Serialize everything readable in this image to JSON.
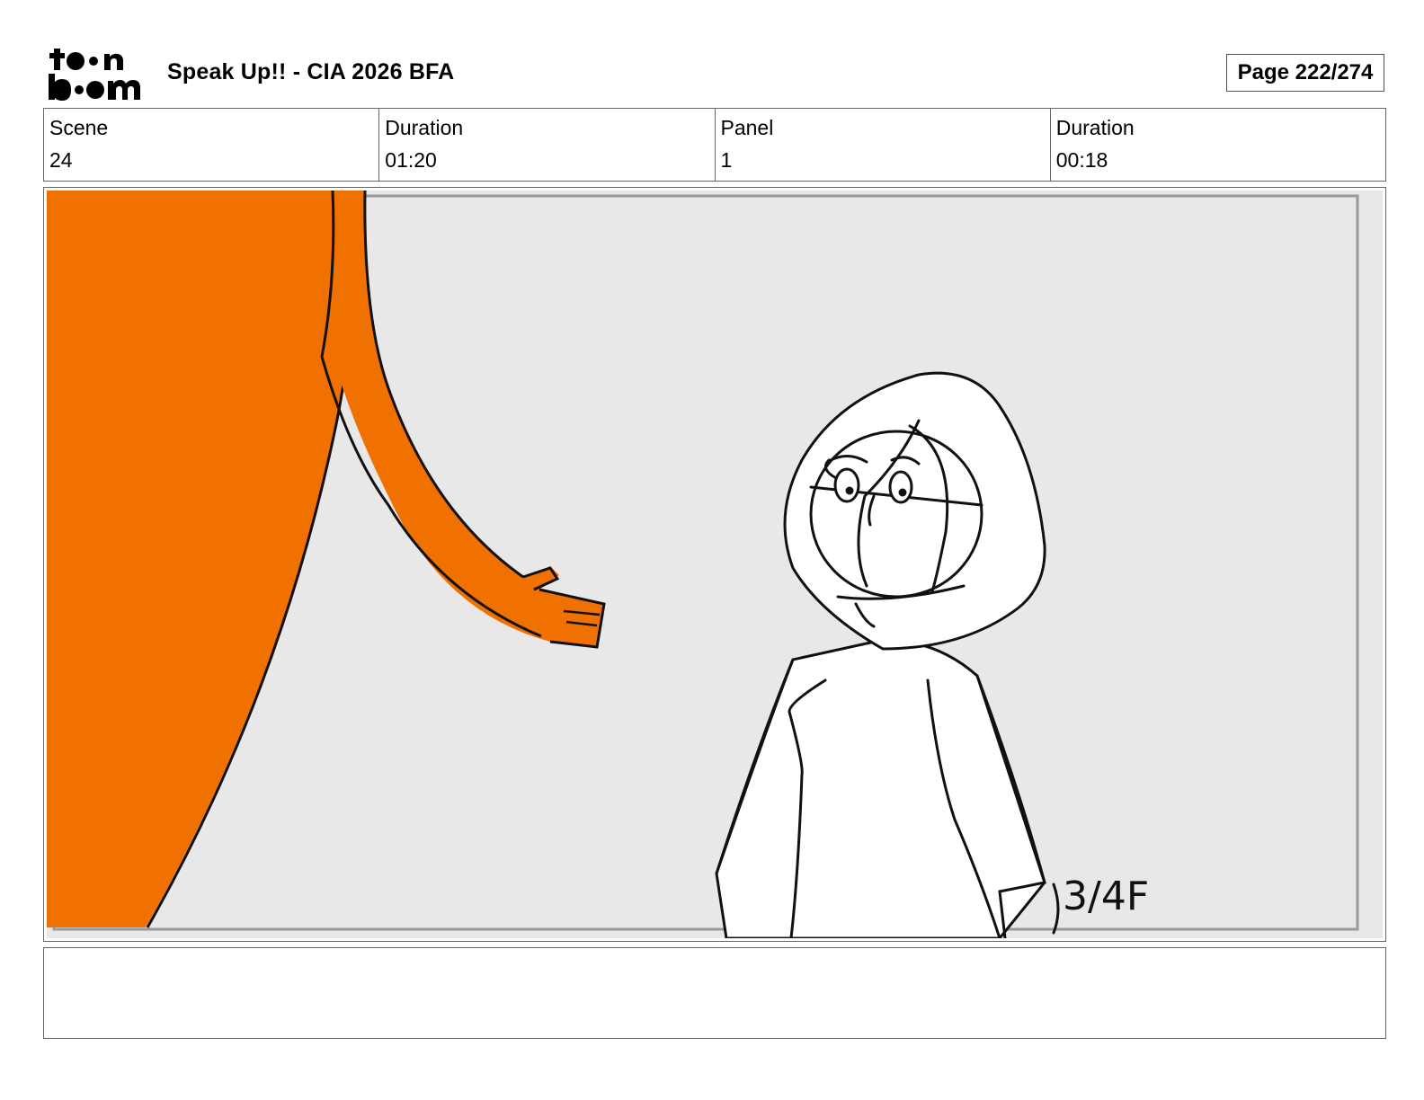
{
  "header": {
    "logo_text": "toon boom",
    "project_title": "Speak Up!! - CIA 2026 BFA",
    "page_label": "Page 222/274"
  },
  "info": [
    {
      "label": "Scene",
      "value": "24"
    },
    {
      "label": "Duration",
      "value": "01:20"
    },
    {
      "label": "Panel",
      "value": "1"
    },
    {
      "label": "Duration",
      "value": "00:18"
    }
  ],
  "panel": {
    "annotation": "3/4F",
    "background_color": "#e8e8e8",
    "character_color": "#f07000"
  },
  "notes": {
    "text": ""
  }
}
